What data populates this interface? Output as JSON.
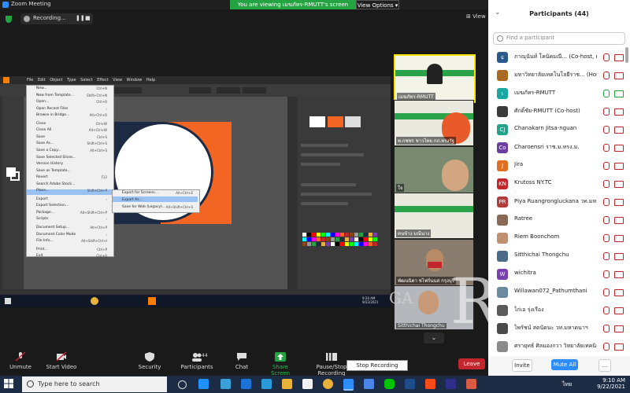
{
  "window": {
    "title": "Zoom Meeting"
  },
  "banner": {
    "share_text": "You are viewing เมฆภัทร-RMUTT's screen",
    "view_options": "View Options ▾"
  },
  "recording": {
    "label": "Recording...",
    "pause": "❚❚",
    "stop": "■"
  },
  "view_button": "⊞ View",
  "illustrator": {
    "menu_items": [
      "File",
      "Edit",
      "Object",
      "Type",
      "Select",
      "Effect",
      "View",
      "Window",
      "Help"
    ],
    "tab_label": "Untitled-1 @ 100 % (RGB/Preview)",
    "file_menu": [
      {
        "label": "New...",
        "key": "Ctrl+N"
      },
      {
        "label": "New from Template...",
        "key": "Shift+Ctrl+N"
      },
      {
        "label": "Open...",
        "key": "Ctrl+O"
      },
      {
        "label": "Open Recent Files",
        "key": "›"
      },
      {
        "label": "Browse in Bridge...",
        "key": "Alt+Ctrl+O"
      },
      {
        "label": "Close",
        "key": "Ctrl+W"
      },
      {
        "label": "Close All",
        "key": "Alt+Ctrl+W"
      },
      {
        "label": "Save",
        "key": "Ctrl+S"
      },
      {
        "label": "Save As...",
        "key": "Shift+Ctrl+S"
      },
      {
        "label": "Save a Copy...",
        "key": "Alt+Ctrl+S"
      },
      {
        "label": "Save Selected Slices...",
        "key": ""
      },
      {
        "label": "Version History",
        "key": ""
      },
      {
        "label": "Save as Template...",
        "key": ""
      },
      {
        "label": "Revert",
        "key": "F12"
      },
      {
        "label": "Search Adobe Stock...",
        "key": ""
      },
      {
        "label": "Place...",
        "key": "Shift+Ctrl+P"
      },
      {
        "label": "Export",
        "key": "›"
      },
      {
        "label": "Export Selection...",
        "key": ""
      },
      {
        "label": "Package...",
        "key": "Alt+Shift+Ctrl+P"
      },
      {
        "label": "Scripts",
        "key": "›"
      },
      {
        "label": "Document Setup...",
        "key": "Alt+Ctrl+P"
      },
      {
        "label": "Document Color Mode",
        "key": "›"
      },
      {
        "label": "File Info...",
        "key": "Alt+Shift+Ctrl+I"
      },
      {
        "label": "Print...",
        "key": "Ctrl+P"
      },
      {
        "label": "Exit",
        "key": "Ctrl+Q"
      }
    ],
    "export_submenu": [
      {
        "label": "Export for Screens...",
        "key": "Alt+Ctrl+E"
      },
      {
        "label": "Export As...",
        "key": ""
      },
      {
        "label": "Save for Web (Legacy)...",
        "key": "Alt+Shift+Ctrl+S"
      }
    ],
    "inner_clock": "9:20 AM\n9/22/2021"
  },
  "gallery": [
    {
      "name": "เมฆภัทร-RMUTT"
    },
    {
      "name": "พ.กชพร ชาวไทย กภ.ทรงรัฐ"
    },
    {
      "name": "ใจ"
    },
    {
      "name": "คนข้าง มณีนาง"
    },
    {
      "name": "พัฒนนิตา ชไฟร์นนส กรุงบุรี"
    },
    {
      "name": "Sitthichai Thongchu"
    }
  ],
  "watermark": {
    "small": "GA",
    "big": "R"
  },
  "toolbar": {
    "unmute": "Unmute",
    "start_video": "Start Video",
    "security": "Security",
    "participants": "Participants",
    "participants_count": "44",
    "chat": "Chat",
    "share_screen": "Share Screen",
    "pause_stop": "Pause/Stop Recording",
    "tooltip": "Stop Recording (Alt+C)",
    "leave": "Leave"
  },
  "participants_panel": {
    "title": "Participants (44)",
    "search_placeholder": "Find a participant",
    "items": [
      {
        "initial": "ɕ",
        "color": "#2d5a8c",
        "name": "ภาณุนันท์ โคนิคมณี... (Co-host, me)"
      },
      {
        "initial": "",
        "color": "#a86a20",
        "name": "มหาวิทยาลัยเทคโนโลยีราช... (Host)"
      },
      {
        "initial": "เ",
        "color": "#1aa7a1",
        "name": "เมฆภัทร-RMUTT"
      },
      {
        "initial": "",
        "color": "#3a3a3a",
        "name": "ศักดิ์ชัย-RMUTT (Co-host)"
      },
      {
        "initial": "CJ",
        "color": "#23a38a",
        "name": "Chanakarn Jitsa-nguan"
      },
      {
        "initial": "Co",
        "color": "#6b3fa0",
        "name": "Charoensri ราช.ม.ทรง.ม."
      },
      {
        "initial": "J",
        "color": "#e07020",
        "name": "Jira"
      },
      {
        "initial": "KN",
        "color": "#c4262e",
        "name": "Krutoss NY.TC"
      },
      {
        "initial": "PR",
        "color": "#b23b3b",
        "name": "Piya Ruangrongluckana วท.มหาดนาฯ"
      },
      {
        "initial": "",
        "color": "#8a6a50",
        "name": "Ratree"
      },
      {
        "initial": "",
        "color": "#c09070",
        "name": "Riem Boonchom"
      },
      {
        "initial": "",
        "color": "#4a6a8a",
        "name": "Sitthichai Thongchu"
      },
      {
        "initial": "W",
        "color": "#7a3fb0",
        "name": "wichitra"
      },
      {
        "initial": "",
        "color": "#6a8aa0",
        "name": "Willawan072_Pathumthani"
      },
      {
        "initial": "",
        "color": "#5a5a5a",
        "name": "ไก่เอ รุ่งเรือง"
      },
      {
        "initial": "",
        "color": "#4a4a4a",
        "name": "ไพรัชน์ สดนัดนะ วท.มหาดนาฯ"
      },
      {
        "initial": "",
        "color": "#8a8a8a",
        "name": "ศรายุทธ์ ศิลมองกวา วิทยาลัยเทคนิค..."
      }
    ],
    "invite": "Invite",
    "mute_all": "Mute All",
    "more": "..."
  },
  "taskbar": {
    "search": "Type here to search",
    "time": "9:10 AM",
    "date": "9/22/2021",
    "lang": "ไทย"
  }
}
